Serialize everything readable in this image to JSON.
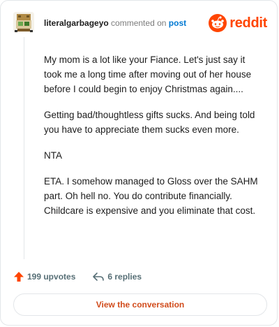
{
  "comment": {
    "username": "literalgarbageyo",
    "action_text": "commented on",
    "target_link": "post",
    "paragraphs": [
      "My mom is a lot like your Fiance. Let's just say it took me a long time after moving out of her house before I could begin to enjoy Christmas again....",
      "Getting bad/thoughtless gifts sucks. And being told you have to appreciate them sucks even more.",
      "NTA",
      "ETA. I somehow managed to Gloss over the SAHM part. Oh hell no. You do contribute financially. Childcare is expensive and you eliminate that cost."
    ]
  },
  "brand": {
    "name": "reddit",
    "color": "#ff4500"
  },
  "footer": {
    "upvotes": "199 upvotes",
    "replies": "6 replies",
    "cta": "View the conversation"
  },
  "colors": {
    "accent": "#ff4500",
    "link": "#0079d3",
    "cta_text": "#d14b1b"
  },
  "icons": {
    "avatar": "robot-avatar",
    "logo": "reddit-snoo-icon",
    "upvote": "upvote-arrow-icon",
    "reply": "reply-arrow-icon"
  }
}
